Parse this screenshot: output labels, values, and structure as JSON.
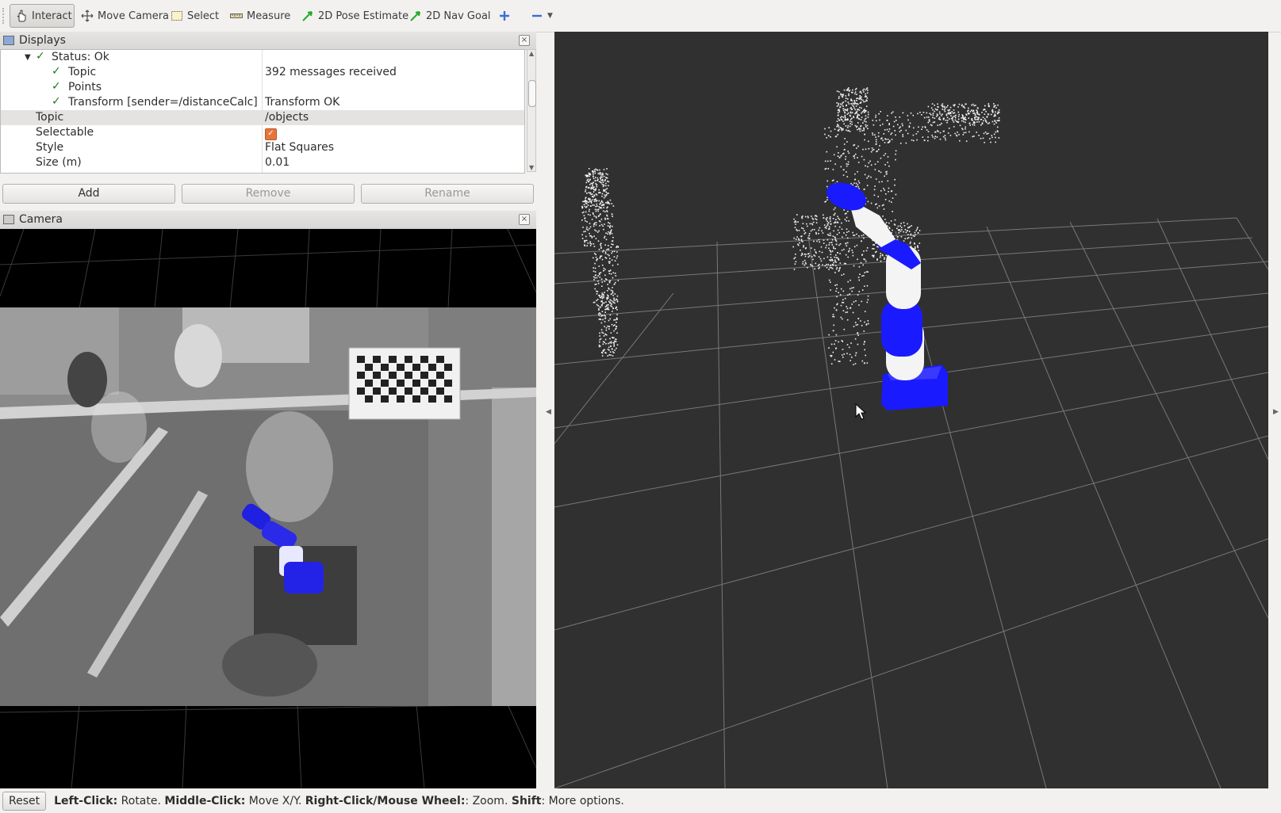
{
  "toolbar": {
    "tools": [
      {
        "label": "Interact",
        "icon": "hand-icon"
      },
      {
        "label": "Move Camera",
        "icon": "move-camera-icon"
      },
      {
        "label": "Select",
        "icon": "select-icon"
      },
      {
        "label": "Measure",
        "icon": "ruler-icon"
      },
      {
        "label": "2D Pose Estimate",
        "icon": "green-arrow-icon"
      },
      {
        "label": "2D Nav Goal",
        "icon": "green-arrow-icon"
      }
    ],
    "add_icon": "plus-icon",
    "remove_icon": "minus-icon"
  },
  "displays": {
    "title": "Displays",
    "rows": [
      {
        "label": "Status: Ok",
        "value": "",
        "checked": true
      },
      {
        "label": "Topic",
        "value": "392 messages received",
        "checked": true
      },
      {
        "label": "Points",
        "value": "",
        "checked": true
      },
      {
        "label": "Transform [sender=/distanceCalc]",
        "value": "Transform OK",
        "checked": true
      },
      {
        "label": "Topic",
        "value": "/objects"
      },
      {
        "label": "Selectable",
        "value": ""
      },
      {
        "label": "Style",
        "value": "Flat Squares"
      },
      {
        "label": "Size (m)",
        "value": "0.01"
      }
    ],
    "buttons": {
      "add": "Add",
      "remove": "Remove",
      "rename": "Rename"
    }
  },
  "camera": {
    "title": "Camera"
  },
  "statusbar": {
    "reset": "Reset",
    "help": [
      {
        "key": "Left-Click:",
        "text": " Rotate. "
      },
      {
        "key": "Middle-Click:",
        "text": " Move X/Y. "
      },
      {
        "key": "Right-Click/Mouse Wheel:",
        "text": ": Zoom. "
      },
      {
        "key": "Shift",
        "text": ": More options."
      }
    ]
  },
  "colors": {
    "robot_blue": "#1a1aff",
    "view_bg": "#303030",
    "check_green": "#1a7a1a"
  }
}
